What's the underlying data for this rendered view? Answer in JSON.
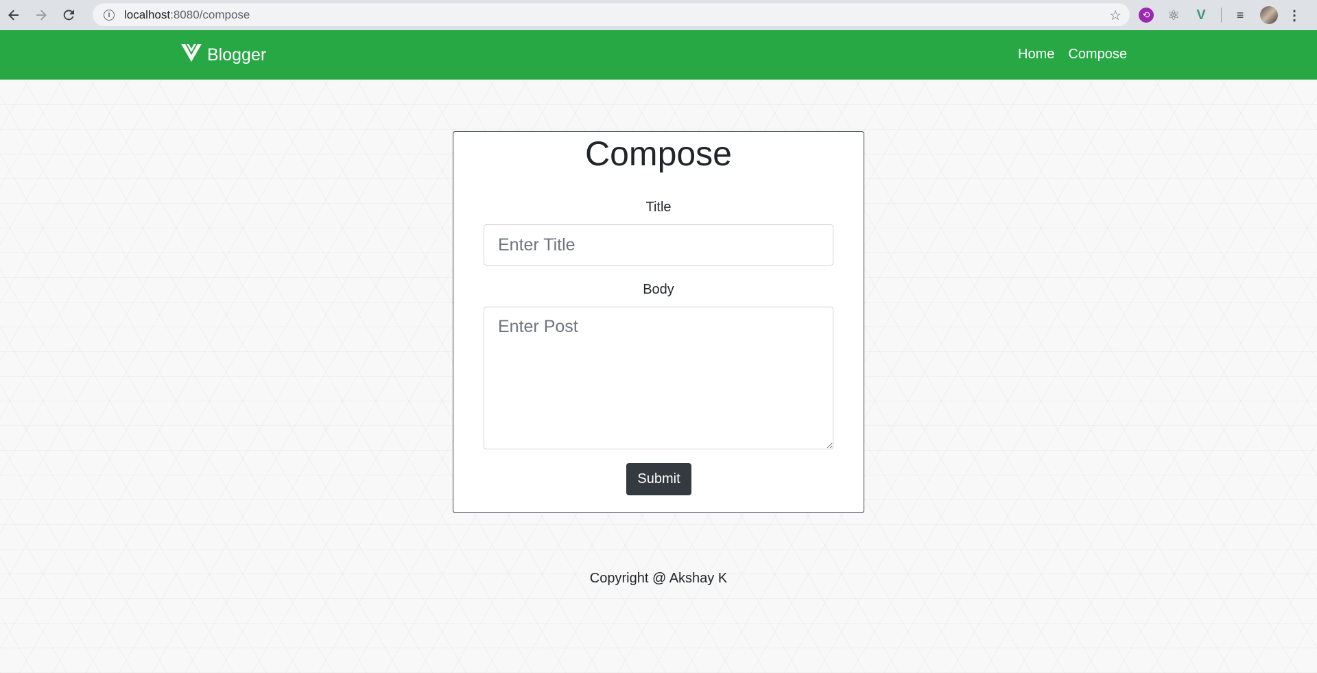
{
  "browser": {
    "url_host": "localhost",
    "url_path": ":8080/compose",
    "info_glyph": "i"
  },
  "navbar": {
    "brand": "Blogger",
    "links": [
      "Home",
      "Compose"
    ],
    "color": "#28a745"
  },
  "compose": {
    "heading": "Compose",
    "title_label": "Title",
    "title_placeholder": "Enter Title",
    "body_label": "Body",
    "body_placeholder": "Enter Post",
    "submit_label": "Submit"
  },
  "footer": {
    "text": "Copyright @ Akshay K"
  },
  "icons": {
    "back": "back-arrow-icon",
    "forward": "forward-arrow-icon",
    "reload": "reload-icon",
    "bookmark": "star-icon",
    "brand_logo": "vue-logo-icon"
  }
}
